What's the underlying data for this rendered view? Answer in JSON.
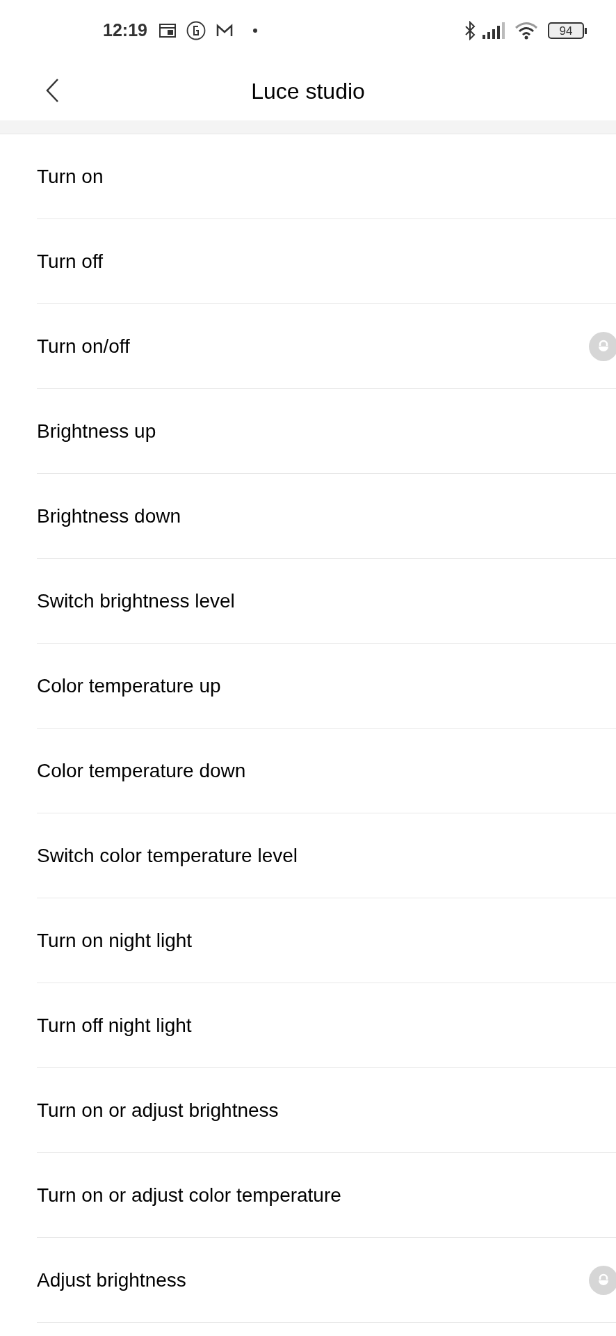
{
  "status_bar": {
    "time": "12:19",
    "battery": "94"
  },
  "header": {
    "title": "Luce studio"
  },
  "items": [
    {
      "label": "Turn on",
      "lock_badge": false
    },
    {
      "label": "Turn off",
      "lock_badge": false
    },
    {
      "label": "Turn on/off",
      "lock_badge": true
    },
    {
      "label": "Brightness up",
      "lock_badge": false
    },
    {
      "label": "Brightness down",
      "lock_badge": false
    },
    {
      "label": "Switch brightness level",
      "lock_badge": false
    },
    {
      "label": "Color temperature up",
      "lock_badge": false
    },
    {
      "label": "Color temperature down",
      "lock_badge": false
    },
    {
      "label": "Switch color temperature level",
      "lock_badge": false
    },
    {
      "label": "Turn on night light",
      "lock_badge": false
    },
    {
      "label": "Turn off night light",
      "lock_badge": false
    },
    {
      "label": "Turn on or adjust brightness",
      "lock_badge": false
    },
    {
      "label": "Turn on or adjust color temperature",
      "lock_badge": false
    },
    {
      "label": "Adjust brightness",
      "lock_badge": true
    }
  ]
}
